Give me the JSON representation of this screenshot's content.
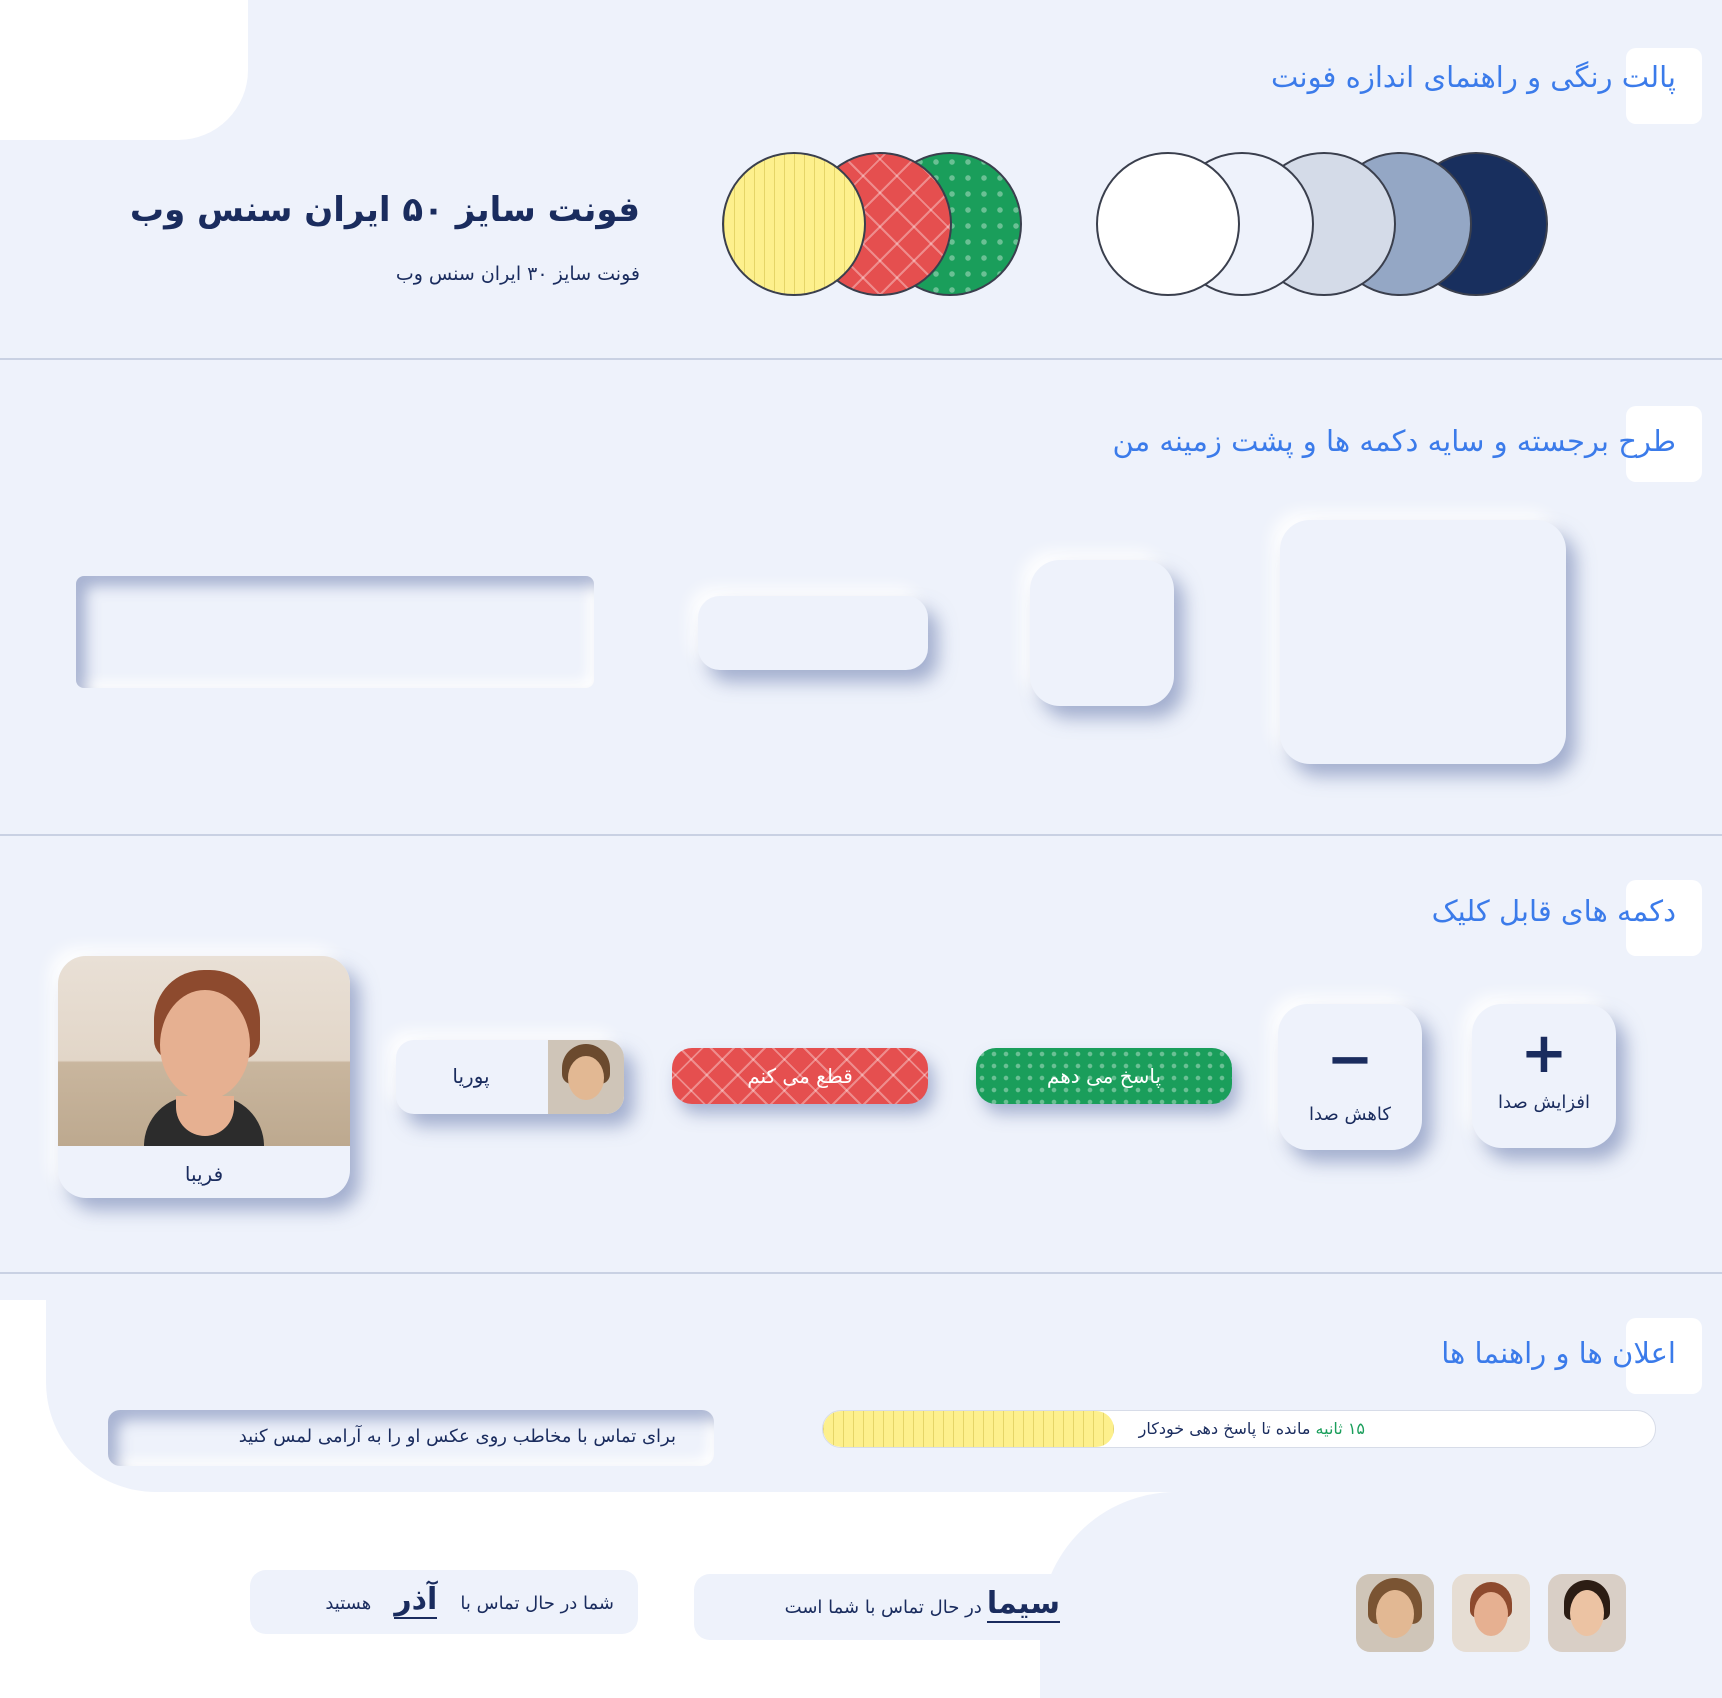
{
  "sections": {
    "palette": {
      "title": "پالت رنگی و راهنمای اندازه فونت"
    },
    "shapes": {
      "title": "طرح برجسته و سایه دکمه ها و پشت زمینه من"
    },
    "buttons": {
      "title": "دکمه های قابل کلیک"
    },
    "notices": {
      "title": "اعلان ها و راهنما ها"
    }
  },
  "typography": {
    "font50": "فونت سایز ۵۰ ایران سنس وب",
    "font30": "فونت سایز ۳۰ ایران سنس وب"
  },
  "colors": {
    "accent_palette": [
      "#fdf08d",
      "#e54f4f",
      "#1a9e5b"
    ],
    "neutral_palette": [
      "#ffffff",
      "#eef2fb",
      "#d4dbe8",
      "#94a7c5",
      "#182f5e"
    ],
    "title_blue": "#3b7bea",
    "text_navy": "#1a2c5e"
  },
  "buttons": {
    "volume_up": {
      "icon": "plus-icon",
      "label": "افزایش صدا"
    },
    "volume_down": {
      "icon": "minus-icon",
      "label": "کاهش صدا"
    },
    "answer": "پاسخ می دهم",
    "hangup": "قطع می کنم",
    "contact_small": "پوریا",
    "contact_large": "فریبا"
  },
  "notices": {
    "countdown": {
      "seconds": "۱۵ ثانیه",
      "text": "مانده تا پاسخ دهی خودکار",
      "progress": 0.35
    },
    "hint": "برای تماس با مخاطب روی عکس او را به آرامی لمس کنید",
    "incoming": {
      "name": "سیما",
      "text": "در حال تماس با شما است"
    },
    "outgoing": {
      "prefix": "شما در حال تماس با",
      "name": "آذر",
      "suffix": "هستید"
    }
  }
}
